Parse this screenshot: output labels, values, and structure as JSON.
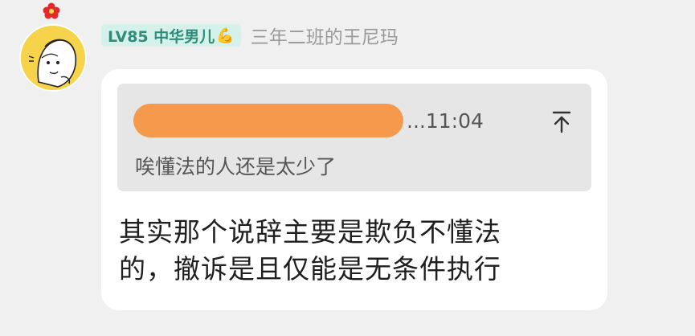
{
  "post": {
    "avatar_icon": "cartoon-avatar-icon",
    "avatar_badge_icon": "red-flower-icon",
    "badge": {
      "label": "LV85 中华男儿",
      "emoji": "💪",
      "bg_color": "#d4f1ea",
      "text_color": "#2f8c7a"
    },
    "username": "三年二班的王尼玛",
    "quote": {
      "time": "...11:04",
      "pin_icon": "pin-top-icon",
      "redaction_color": "#f59a4c",
      "text": "唉懂法的人还是太少了"
    },
    "message": {
      "line1": "其实那个说辞主要是欺负不懂法",
      "line2": "的，撤诉是且仅能是无条件执行"
    }
  }
}
